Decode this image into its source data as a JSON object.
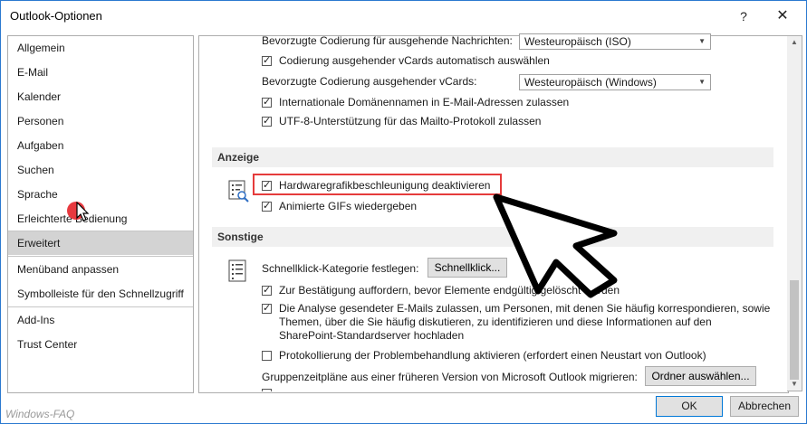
{
  "window": {
    "title": "Outlook-Optionen",
    "help_glyph": "?",
    "close_glyph": "✕"
  },
  "sidebar": {
    "items": [
      {
        "label": "Allgemein"
      },
      {
        "label": "E-Mail"
      },
      {
        "label": "Kalender"
      },
      {
        "label": "Personen"
      },
      {
        "label": "Aufgaben"
      },
      {
        "label": "Suchen"
      },
      {
        "label": "Sprache"
      },
      {
        "label": "Erleichterte Bedienung"
      },
      {
        "label": "Erweitert",
        "selected": true
      },
      {
        "label": "Menüband anpassen"
      },
      {
        "label": "Symbolleiste für den Schnellzugriff"
      },
      {
        "label": "Add-Ins"
      },
      {
        "label": "Trust Center"
      }
    ]
  },
  "encoding": {
    "outgoing_label": "Bevorzugte Codierung für ausgehende Nachrichten:",
    "outgoing_value": "Westeuropäisch (ISO)",
    "vcards_auto_label": "Codierung ausgehender vCards automatisch auswählen",
    "vcards_auto_checked": true,
    "vcards_label": "Bevorzugte Codierung ausgehender vCards:",
    "vcards_value": "Westeuropäisch (Windows)",
    "idn_label": "Internationale Domänennamen in E-Mail-Adressen zulassen",
    "idn_checked": true,
    "utf8_label": "UTF-8-Unterstützung für das Mailto-Protokoll zulassen",
    "utf8_checked": true
  },
  "display": {
    "header": "Anzeige",
    "hw_accel_label": "Hardwaregrafikbeschleunigung deaktivieren",
    "hw_accel_checked": true,
    "gif_label": "Animierte GIFs wiedergeben",
    "gif_checked": true
  },
  "other": {
    "header": "Sonstige",
    "quickclick_label": "Schnellklick-Kategorie festlegen:",
    "quickclick_button": "Schnellklick...",
    "confirm_label": "Zur Bestätigung auffordern, bevor Elemente endgültig gelöscht werden",
    "confirm_checked": true,
    "analysis_label_1": "Die Analyse gesendeter E-Mails zulassen, um Personen, mit denen Sie häufig korrespondieren, sowie",
    "analysis_label_2": "Themen, über die Sie häufig diskutieren, zu identifizieren und diese Informationen auf den",
    "analysis_label_3": "SharePoint-Standardserver hochladen",
    "analysis_checked": true,
    "logging_label": "Protokollierung der Problembehandlung aktivieren (erfordert einen Neustart von Outlook)",
    "logging_checked": false,
    "migrate_label": "Gruppenzeitpläne aus einer früheren Version von Microsoft Outlook migrieren:",
    "migrate_button": "Ordner auswählen..."
  },
  "footer": {
    "ok": "OK",
    "cancel": "Abbrechen"
  },
  "watermark": "Windows-FAQ"
}
